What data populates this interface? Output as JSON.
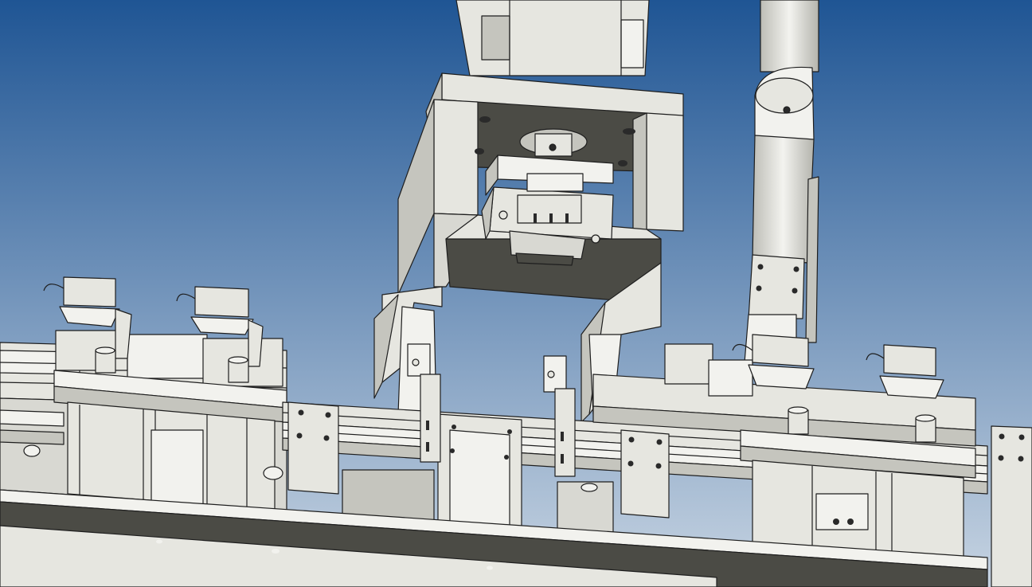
{
  "viewport": {
    "background_top": "#1f5594",
    "background_bottom": "#c7d4e2"
  },
  "colors": {
    "part": "#e6e6e0",
    "part_light": "#f2f2ee",
    "part_shade": "#c5c5be",
    "part_dark": "#4b4b45",
    "edge": "#1e1e1e",
    "hole": "#2a2a2a"
  },
  "model": {
    "description_hidden": "",
    "components": [
      "upper-column",
      "gripper-frame",
      "gripper-head",
      "vertical-actuator-rod",
      "guide-rail",
      "slider-blocks",
      "motor-units",
      "base-plate"
    ]
  }
}
